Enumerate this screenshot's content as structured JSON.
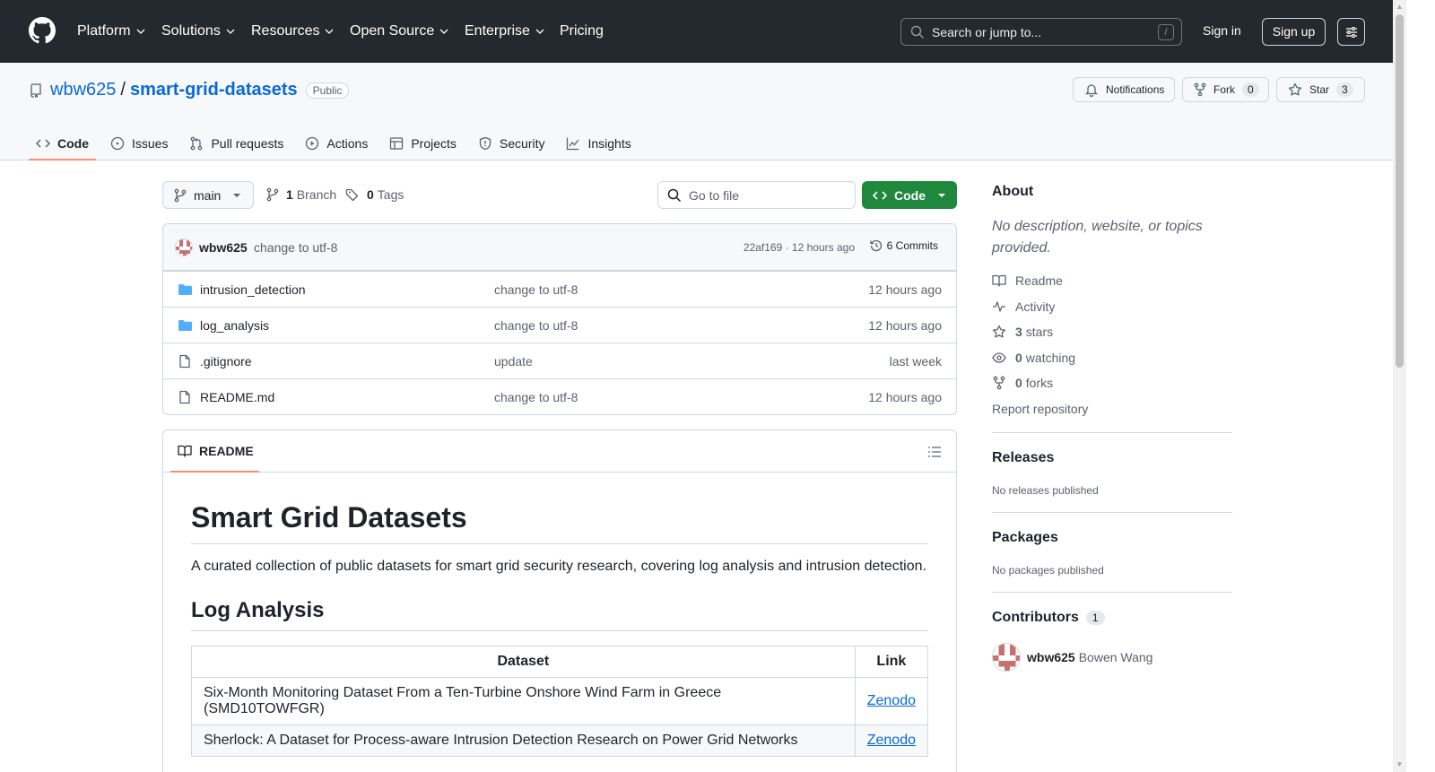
{
  "header": {
    "nav": [
      "Platform",
      "Solutions",
      "Resources",
      "Open Source",
      "Enterprise",
      "Pricing"
    ],
    "search_placeholder": "Search or jump to...",
    "search_shortcut": "/",
    "sign_in": "Sign in",
    "sign_up": "Sign up"
  },
  "repo": {
    "owner": "wbw625",
    "separator": "/",
    "name": "smart-grid-datasets",
    "visibility": "Public",
    "notifications_label": "Notifications",
    "fork_label": "Fork",
    "fork_count": "0",
    "star_label": "Star",
    "star_count": "3",
    "tabs": [
      "Code",
      "Issues",
      "Pull requests",
      "Actions",
      "Projects",
      "Security",
      "Insights"
    ],
    "active_tab": "Code"
  },
  "toolbar": {
    "branch": "main",
    "branch_count": "1",
    "branch_label": "Branch",
    "tag_count": "0",
    "tag_label": "Tags",
    "goto_placeholder": "Go to file",
    "code_button": "Code"
  },
  "commit": {
    "user": "wbw625",
    "message": "change to utf-8",
    "meta": "22af169 · 12 hours ago",
    "commits_label": "6 Commits"
  },
  "files": [
    {
      "type": "folder",
      "name": "intrusion_detection",
      "message": "change to utf-8",
      "age": "12 hours ago"
    },
    {
      "type": "folder",
      "name": "log_analysis",
      "message": "change to utf-8",
      "age": "12 hours ago"
    },
    {
      "type": "file",
      "name": ".gitignore",
      "message": "update",
      "age": "last week"
    },
    {
      "type": "file",
      "name": "README.md",
      "message": "change to utf-8",
      "age": "12 hours ago"
    }
  ],
  "readme": {
    "tab": "README",
    "title": "Smart Grid Datasets",
    "intro": "A curated collection of public datasets for smart grid security research, covering log analysis and intrusion detection.",
    "section_title": "Log Analysis",
    "table_headers": [
      "Dataset",
      "Link"
    ],
    "rows": [
      {
        "dataset": "Six-Month Monitoring Dataset From a Ten-Turbine Onshore Wind Farm in Greece (SMD10TOWFGR)",
        "link": "Zenodo"
      },
      {
        "dataset": "Sherlock: A Dataset for Process-aware Intrusion Detection Research on Power Grid Networks",
        "link": "Zenodo"
      }
    ]
  },
  "sidebar": {
    "about_title": "About",
    "about_desc": "No description, website, or topics provided.",
    "readme_link": "Readme",
    "activity_link": "Activity",
    "stars_count": "3",
    "stars_label": "stars",
    "watching_count": "0",
    "watching_label": "watching",
    "forks_count": "0",
    "forks_label": "forks",
    "report": "Report repository",
    "releases_title": "Releases",
    "releases_note": "No releases published",
    "packages_title": "Packages",
    "packages_note": "No packages published",
    "contributors_title": "Contributors",
    "contributors_count": "1",
    "contributor_user": "wbw625",
    "contributor_name": "Bowen Wang"
  },
  "colors": {
    "header_bg": "#24292f",
    "link": "#0969da",
    "primary_button": "#1f883d",
    "active_tab_underline": "#fd8c73",
    "folder_icon": "#54aeff"
  }
}
